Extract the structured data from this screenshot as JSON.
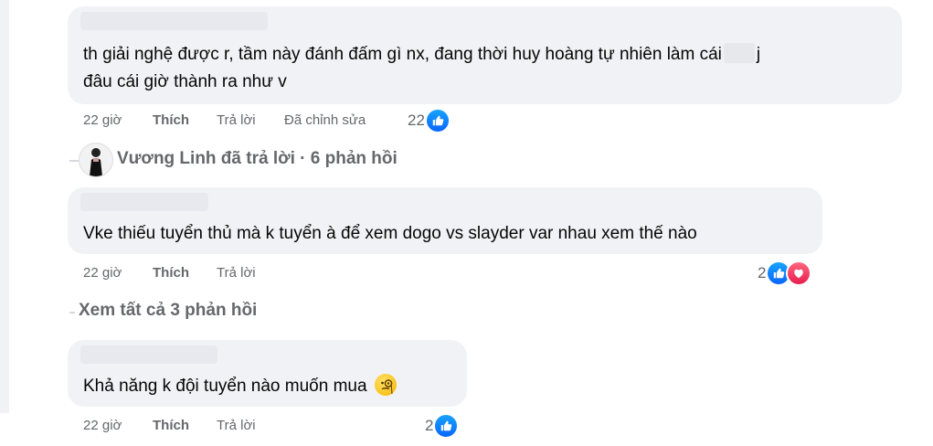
{
  "comments": [
    {
      "line1": "th giải nghệ được r, tầm này đánh đấm gì nx, đang thời huy hoàng tự nhiên làm cái",
      "line1_tail": "j",
      "line2": "đâu cái giờ thành ra như v",
      "time": "22 giờ",
      "like": "Thích",
      "reply": "Trả lời",
      "edited": "Đã chỉnh sửa",
      "reaction_count": "22"
    },
    {
      "text": "Vke thiếu tuyển thủ mà k tuyển à để xem dogo vs slayder var nhau xem thế nào",
      "time": "22 giờ",
      "like": "Thích",
      "reply": "Trả lời",
      "reaction_count": "2"
    },
    {
      "text": "Khả năng k đội tuyển nào muốn mua",
      "time": "22 giờ",
      "like": "Thích",
      "reply": "Trả lời",
      "reaction_count": "2"
    }
  ],
  "replies_summary": {
    "text": "Vương Linh đã trả lời · 6 phản hồi"
  },
  "view_all_replies": "Xem tất cả 3 phản hồi",
  "colors": {
    "bubble": "#f0f2f5",
    "meta": "#65676b",
    "like_blue": "#0866ff",
    "love_red": "#e61e4d"
  },
  "icons": {
    "like": "thumbs-up-icon",
    "love": "heart-icon",
    "emoji": "monocle-face-emoji"
  }
}
